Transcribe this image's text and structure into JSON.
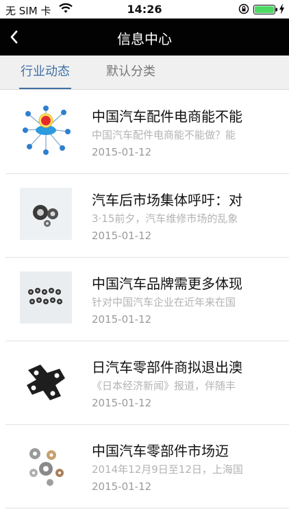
{
  "status": {
    "carrier": "无 SIM 卡",
    "time": "14:26",
    "wifi_icon": "wifi-icon",
    "lock_icon": "rotation-lock-icon",
    "battery_icon": "battery-icon",
    "battery_level": 1.0,
    "battery_color": "#4cd964"
  },
  "header": {
    "title": "信息中心",
    "back_icon": "chevron-left-icon",
    "background": "#020202"
  },
  "tabs": [
    {
      "label": "行业动态",
      "active": true,
      "color": "#3f6fa4"
    },
    {
      "label": "默认分类",
      "active": false,
      "color": "#777777"
    }
  ],
  "items": [
    {
      "title": "中国汽车配件电商能不能",
      "summary": "中国汽车配件电商能不能做？能",
      "date": "2015-01-12",
      "thumb_icon": "b2b-network-icon"
    },
    {
      "title": "汽车后市场集体呼吁：对",
      "summary": "3·15前夕，汽车维修市场的乱象",
      "date": "2015-01-12",
      "thumb_icon": "bearing-parts-icon"
    },
    {
      "title": "中国汽车品牌需更多体现",
      "summary": "针对中国汽车企业在近年来在国",
      "date": "2015-01-12",
      "thumb_icon": "bushing-parts-icon"
    },
    {
      "title": "日汽车零部件商拟退出澳",
      "summary": "《日本经济新闻》报道，伴随丰",
      "date": "2015-01-12",
      "thumb_icon": "bracket-part-icon"
    },
    {
      "title": "中国汽车零部件市场迈",
      "summary": "2014年12月9日至12日，上海国",
      "date": "2015-01-12",
      "thumb_icon": "metal-parts-icon"
    }
  ]
}
